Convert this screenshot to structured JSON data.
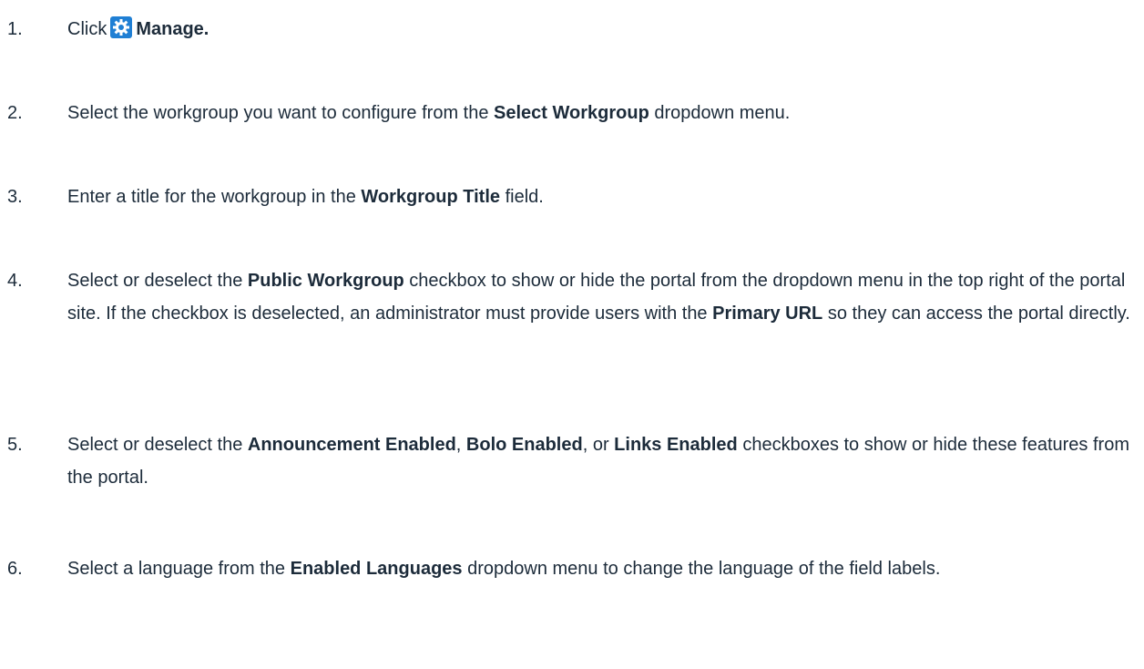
{
  "steps": [
    {
      "number": "1.",
      "parts": [
        "Click",
        "Manage."
      ],
      "icon": "gear-icon"
    },
    {
      "number": "2.",
      "parts": [
        "Select the workgroup you want to configure from the ",
        "Select Workgroup",
        " dropdown menu."
      ]
    },
    {
      "number": "3.",
      "parts": [
        "Enter a title for the workgroup in the ",
        "Workgroup Title",
        " field."
      ]
    },
    {
      "number": "4.",
      "parts": [
        "Select or deselect the ",
        "Public Workgroup",
        " checkbox to show or hide the portal from the dropdown menu in the top right of the portal site. If the checkbox is deselected, an administrator must provide users with the ",
        "Primary URL",
        " so they can access the portal directly."
      ]
    },
    {
      "number": "5.",
      "parts": [
        "Select or deselect the ",
        "Announcement Enabled",
        ", ",
        "Bolo Enabled",
        ", or ",
        "Links Enabled",
        " checkboxes to show or hide these features from the portal."
      ]
    },
    {
      "number": "6.",
      "parts": [
        "Select a language from the ",
        "Enabled Languages",
        " dropdown menu to change the language of the field labels."
      ]
    }
  ],
  "colors": {
    "text": "#1c2b3a",
    "icon_bg": "#1f7fd4"
  }
}
